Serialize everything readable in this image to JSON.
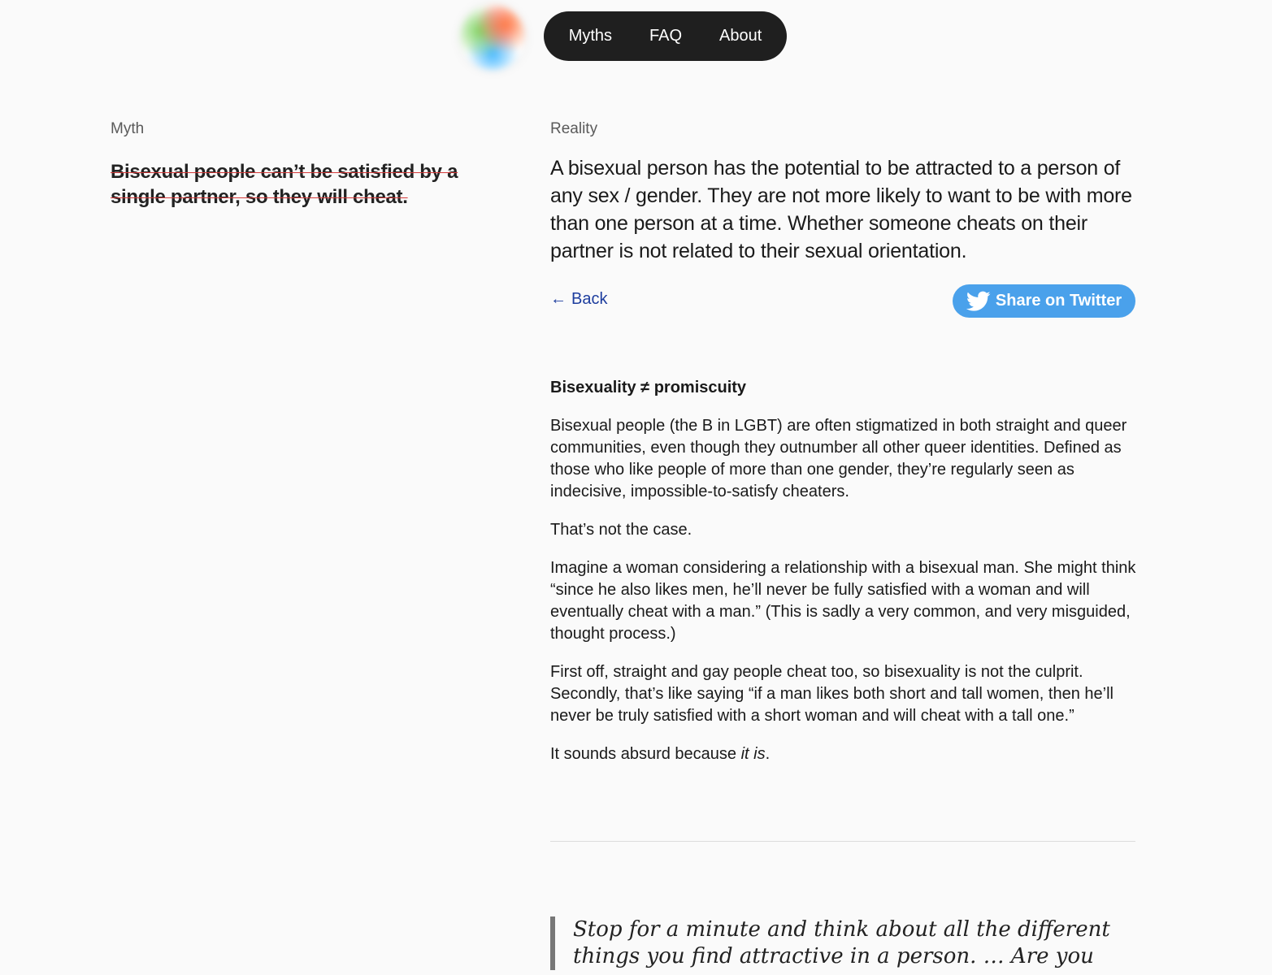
{
  "nav": {
    "items": [
      {
        "label": "Myths"
      },
      {
        "label": "FAQ"
      },
      {
        "label": "About"
      }
    ]
  },
  "myth": {
    "label": "Myth",
    "text": "Bisexual people can’t be satisfied by a single partner, so they will cheat."
  },
  "reality": {
    "label": "Reality",
    "text": "A bisexual person has the potential to be attracted to a person of any sex / gender. They are not more likely to want to be with more than one person at a time. Whether someone cheats on their partner is not related to their sexual orientation."
  },
  "actions": {
    "back_arrow": "←",
    "back_label": "Back",
    "share_label": "Share on Twitter"
  },
  "article": {
    "heading": "Bisexuality ≠ promiscuity",
    "p1": "Bisexual people (the B in LGBT) are often stigmatized in both straight and queer communities, even though they outnumber all other queer identities. Defined as those who like people of more than one gender, they’re regularly seen as indecisive, impossible-to-satisfy cheaters.",
    "p2": "That’s not the case.",
    "p3": "Imagine a woman considering a relationship with a bisexual man. She might think “since he also likes men, he’ll never be fully satisfied with a woman and will eventually cheat with a man.” (This is sadly a very common, and very misguided, thought process.)",
    "p4": "First off, straight and gay people cheat too, so bisexuality is not the culprit. Secondly, that’s like saying “if a man likes both short and tall women, then he’ll never be truly satisfied with a short woman and will cheat with a tall one.”",
    "p5_prefix": "It sounds absurd because ",
    "p5_emphasis": "it is",
    "p5_suffix": "."
  },
  "quote": {
    "text": "Stop for a minute and think about all the different things you find attractive in a person. … Are you"
  },
  "colors": {
    "background": "#fafafa",
    "nav_background": "#1f1f1f",
    "strike": "#d43a3a",
    "link": "#1d3d9e",
    "twitter": "#4aa1eb"
  },
  "icons": {
    "logo": "gradient-orb-logo",
    "back": "left-arrow-icon",
    "share": "twitter-bird-icon"
  }
}
